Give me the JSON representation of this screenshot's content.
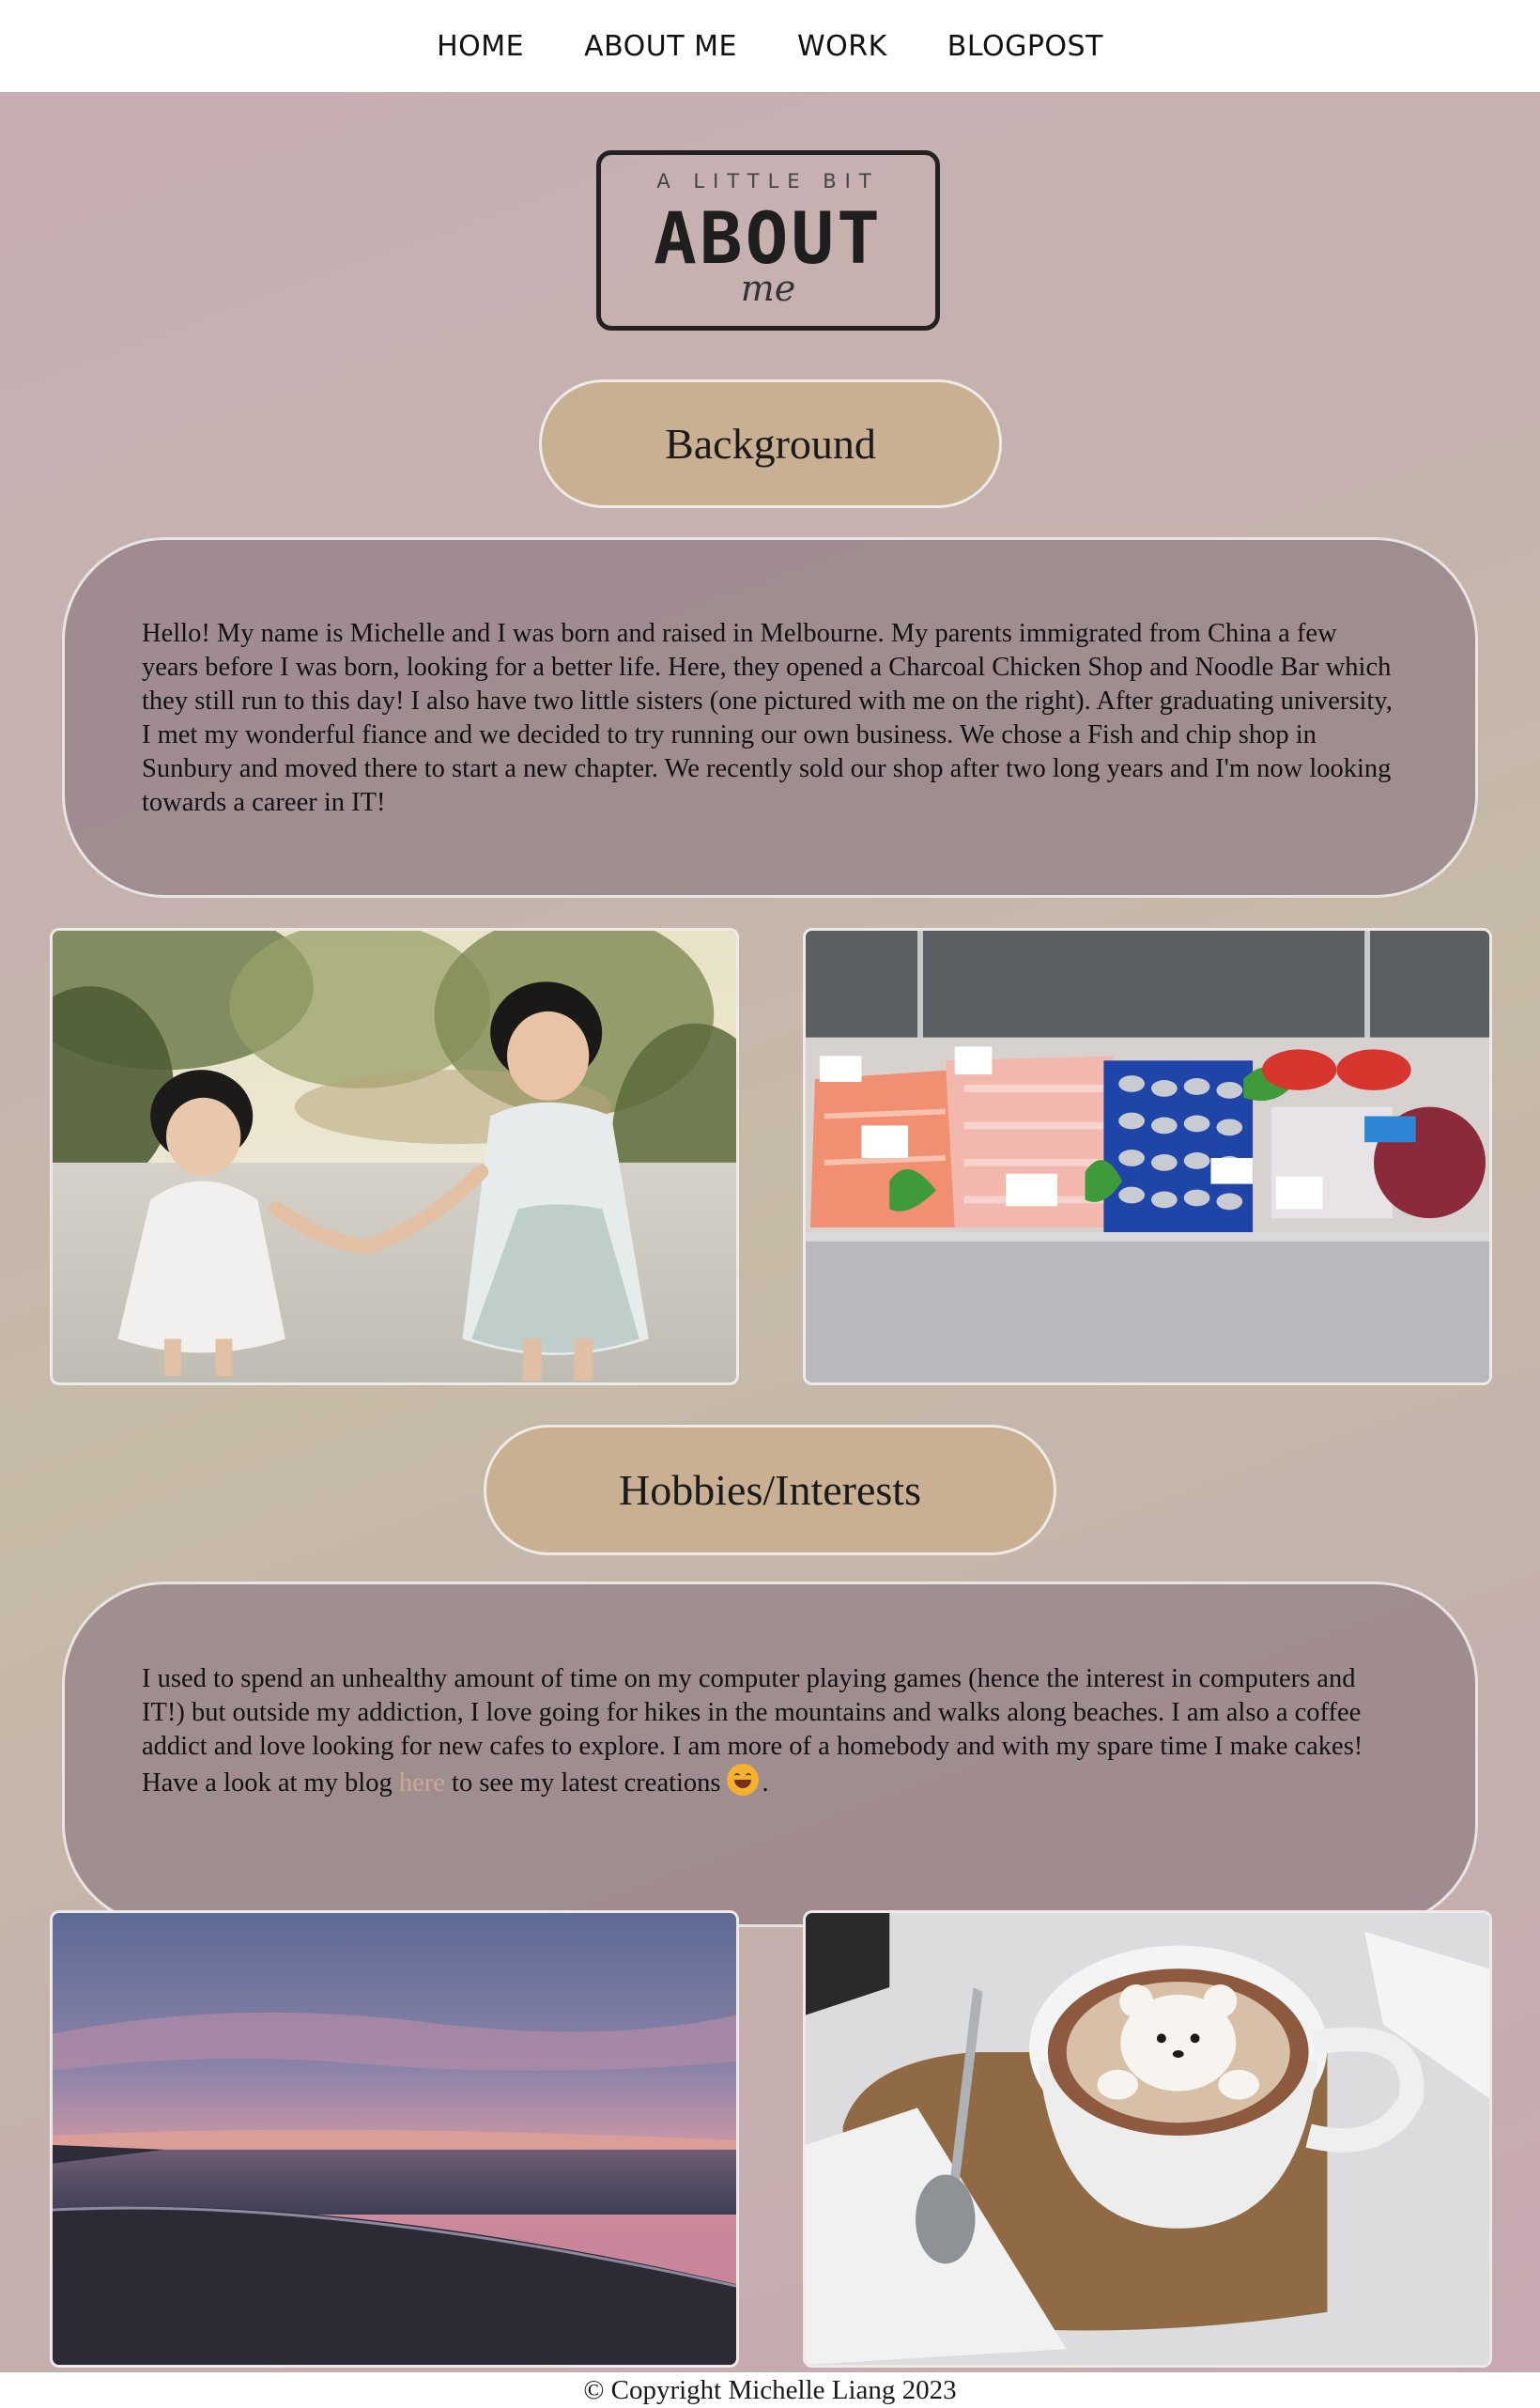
{
  "nav": {
    "items": [
      {
        "label": "HOME"
      },
      {
        "label": "ABOUT ME"
      },
      {
        "label": "WORK"
      },
      {
        "label": "BLOGPOST"
      }
    ]
  },
  "logo": {
    "top": "A LITTLE BIT",
    "main": "ABOUT",
    "sub": "me"
  },
  "sections": {
    "background": {
      "heading": "Background",
      "text": "Hello! My name is Michelle and I was born and raised in Melbourne. My parents immigrated from China a few years before I was born, looking for a better life. Here, they opened a Charcoal Chicken Shop and Noodle Bar which they still run to this day! I also have two little sisters (one pictured with me on the right). After graduating university, I met my wonderful fiance and we decided to try running our own business. We chose a Fish and chip shop in Sunbury and moved there to start a new chapter. We recently sold our shop after two long years and I'm now looking towards a career in IT!"
    },
    "hobbies": {
      "heading": "Hobbies/Interests",
      "text_before": "I used to spend an unhealthy amount of time on my computer playing games (hence the interest in computers and IT!) but outside my addiction, I love going for hikes in the mountains and walks along beaches. I am also a coffee addict and love looking for new cafes to explore. I am more of a homebody and with my spare time I make cakes! Have a look at my blog ",
      "link": "here",
      "text_after": " to see my latest creations",
      "text_end": ".",
      "emoji": "grinning-face-icon"
    }
  },
  "footer": {
    "copyright": "© Copyright Michelle Liang 2023"
  },
  "colors": {
    "pill": "#c9b093",
    "panel": "#927e84",
    "link": "#c8a896",
    "nav_bg": "#ffffff"
  }
}
